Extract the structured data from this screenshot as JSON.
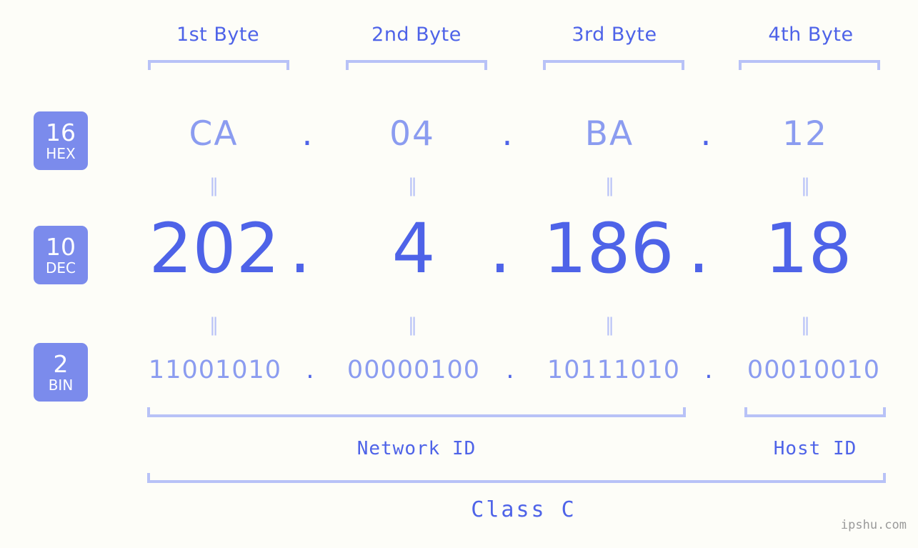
{
  "watermark": "ipshu.com",
  "byte_headers": [
    {
      "label": "1st Byte"
    },
    {
      "label": "2nd Byte"
    },
    {
      "label": "3rd Byte"
    },
    {
      "label": "4th Byte"
    }
  ],
  "rows": [
    {
      "badge_number": "16",
      "badge_base": "HEX",
      "values": [
        "CA",
        "04",
        "BA",
        "12"
      ],
      "separator": "."
    },
    {
      "badge_number": "10",
      "badge_base": "DEC",
      "values": [
        "202",
        "4",
        "186",
        "18"
      ],
      "separator": "."
    },
    {
      "badge_number": "2",
      "badge_base": "BIN",
      "values": [
        "11001010",
        "00000100",
        "10111010",
        "00010010"
      ],
      "separator": "."
    }
  ],
  "equality_marker": "‖",
  "sections": {
    "network_id": "Network ID",
    "host_id": "Host ID",
    "class": "Class C"
  },
  "colors": {
    "background": "#fdfdf8",
    "accent_strong": "#4e63e8",
    "accent_light": "#8b9cf0",
    "bracket": "#b8c2f7",
    "badge_bg": "#7b8bec",
    "badge_text": "#ffffff",
    "watermark": "#9a9a9a"
  },
  "ip_address": {
    "hex": "CA.04.BA.12",
    "dec": "202.4.186.18",
    "bin": "11001010.00000100.10111010.00010010"
  }
}
